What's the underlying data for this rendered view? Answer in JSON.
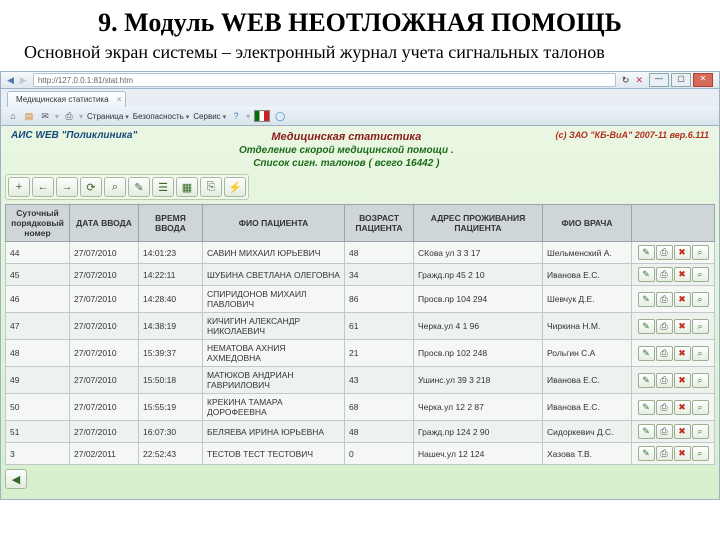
{
  "slide": {
    "title": "9. Модуль WEB НЕОТЛОЖНАЯ ПОМОЩЬ",
    "subtitle": "Основной экран системы – электронный журнал учета сигнальных талонов"
  },
  "browser": {
    "url": "http://127.0.0.1:81/stat.htm",
    "tab_title": "Медицинская статистика",
    "toolbar": {
      "page": "Страница",
      "security": "Безопасность",
      "service": "Сервис"
    },
    "win": {
      "min": "—",
      "max": "▢",
      "close": "✕"
    }
  },
  "page_header": {
    "left": "АИС WEB \"Поликлиника\"",
    "center_line1": "Медицинская статистика",
    "center_line2": "Отделение скорой медицинской помощи .",
    "center_line3": "Список сигн. талонов ( всего 16442 )",
    "right": "(c) ЗАО \"КБ-ВиА\" 2007-11 вер.6.111"
  },
  "actions": [
    "+",
    "←",
    "→",
    "⟳",
    "⌕",
    "✎",
    "☰",
    "▦",
    "⎘",
    "⚡"
  ],
  "columns": {
    "c0": "Суточный порядковый номер",
    "c1": "ДАТА ВВОДА",
    "c2": "ВРЕМЯ ВВОДА",
    "c3": "ФИО ПАЦИЕНТА",
    "c4": "ВОЗРАСТ ПАЦИЕНТА",
    "c5": "АДРЕС ПРОЖИВАНИЯ ПАЦИЕНТА",
    "c6": "ФИО ВРАЧА",
    "c7": ""
  },
  "rows": [
    {
      "n": "44",
      "date": "27/07/2010",
      "time": "14:01:23",
      "fio": "САВИН МИХАИЛ ЮРЬЕВИЧ",
      "age": "48",
      "addr": "СКова ул 3 3 17",
      "doc": "Шельменский А."
    },
    {
      "n": "45",
      "date": "27/07/2010",
      "time": "14:22:11",
      "fio": "ШУБИНА СВЕТЛАНА ОЛЕГОВНА",
      "age": "34",
      "addr": "Гражд.пр 45 2 10",
      "doc": "Иванова Е.С."
    },
    {
      "n": "46",
      "date": "27/07/2010",
      "time": "14:28:40",
      "fio": "СПИРИДОНОВ МИХАИЛ ПАВЛОВИЧ",
      "age": "86",
      "addr": "Просв.пр 104 294",
      "doc": "Шевчук Д.Е."
    },
    {
      "n": "47",
      "date": "27/07/2010",
      "time": "14:38:19",
      "fio": "КИЧИГИН АЛЕКСАНДР НИКОЛАЕВИЧ",
      "age": "61",
      "addr": "Черка.ул 4 1 96",
      "doc": "Чиркина Н.М."
    },
    {
      "n": "48",
      "date": "27/07/2010",
      "time": "15:39:37",
      "fio": "НЕМАТОВА АХНИЯ АХМЕДОВНА",
      "age": "21",
      "addr": "Просв.пр 102 248",
      "doc": "Рольгин С.А"
    },
    {
      "n": "49",
      "date": "27/07/2010",
      "time": "15:50:18",
      "fio": "МАТЮКОВ АНДРИАН ГАВРИИЛОВИЧ",
      "age": "43",
      "addr": "Ушинс.ул 39 3 218",
      "doc": "Иванова Е.С."
    },
    {
      "n": "50",
      "date": "27/07/2010",
      "time": "15:55:19",
      "fio": "КРЕКИНА ТАМАРА ДОРОФЕЕВНА",
      "age": "68",
      "addr": "Черка.ул 12 2 87",
      "doc": "Иванова Е.С."
    },
    {
      "n": "51",
      "date": "27/07/2010",
      "time": "16:07:30",
      "fio": "БЕЛЯЕВА ИРИНА ЮРЬЕВНА",
      "age": "48",
      "addr": "Гражд.пр 124 2 90",
      "doc": "Сидоркевич Д.С."
    },
    {
      "n": "3",
      "date": "27/02/2011",
      "time": "22:52:43",
      "fio": "ТЕСТОВ ТЕСТ ТЕСТОВИЧ",
      "age": "0",
      "addr": "Нашеч.ул 12 124",
      "doc": "Хазова Т.В."
    }
  ],
  "row_action_icons": {
    "edit": "✎",
    "print": "⎙",
    "delete": "✖",
    "view": "⌕"
  }
}
